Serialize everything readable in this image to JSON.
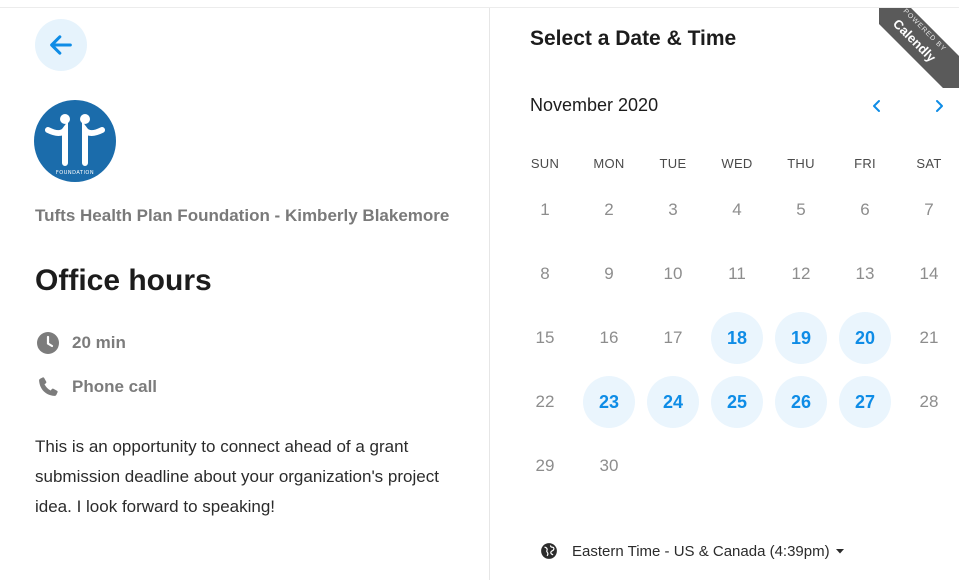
{
  "left": {
    "organization": "Tufts Health Plan Foundation - Kimberly Blakemore",
    "event_title": "Office hours",
    "duration": "20 min",
    "location": "Phone call",
    "description": "This is an opportunity to connect ahead of a grant submission deadline about your organization's project idea. I look forward to speaking!",
    "logo_text": "FOUNDATION"
  },
  "calendar": {
    "title": "Select a Date & Time",
    "month": "November 2020",
    "weekdays": [
      "SUN",
      "MON",
      "TUE",
      "WED",
      "THU",
      "FRI",
      "SAT"
    ],
    "days": [
      {
        "n": "1",
        "available": false
      },
      {
        "n": "2",
        "available": false
      },
      {
        "n": "3",
        "available": false
      },
      {
        "n": "4",
        "available": false
      },
      {
        "n": "5",
        "available": false
      },
      {
        "n": "6",
        "available": false
      },
      {
        "n": "7",
        "available": false
      },
      {
        "n": "8",
        "available": false
      },
      {
        "n": "9",
        "available": false
      },
      {
        "n": "10",
        "available": false
      },
      {
        "n": "11",
        "available": false
      },
      {
        "n": "12",
        "available": false
      },
      {
        "n": "13",
        "available": false
      },
      {
        "n": "14",
        "available": false
      },
      {
        "n": "15",
        "available": false
      },
      {
        "n": "16",
        "available": false
      },
      {
        "n": "17",
        "available": false
      },
      {
        "n": "18",
        "available": true
      },
      {
        "n": "19",
        "available": true
      },
      {
        "n": "20",
        "available": true
      },
      {
        "n": "21",
        "available": false
      },
      {
        "n": "22",
        "available": false
      },
      {
        "n": "23",
        "available": true
      },
      {
        "n": "24",
        "available": true
      },
      {
        "n": "25",
        "available": true
      },
      {
        "n": "26",
        "available": true
      },
      {
        "n": "27",
        "available": true
      },
      {
        "n": "28",
        "available": false
      },
      {
        "n": "29",
        "available": false
      },
      {
        "n": "30",
        "available": false
      }
    ],
    "timezone": "Eastern Time - US & Canada (4:39pm)"
  },
  "ribbon": {
    "small": "POWERED BY",
    "big": "Calendly"
  },
  "icons": {
    "back": "arrow-left-icon",
    "prev": "chevron-left-icon",
    "next": "chevron-right-icon",
    "clock": "clock-icon",
    "phone": "phone-icon",
    "globe": "globe-icon",
    "caret": "caret-down-icon"
  },
  "colors": {
    "accent": "#0e8ce6",
    "available_bg": "#eaf5fd",
    "back_bg": "#e6f3fc",
    "logo_bg": "#1b6cab",
    "ribbon_bg": "#5a5a5a"
  }
}
